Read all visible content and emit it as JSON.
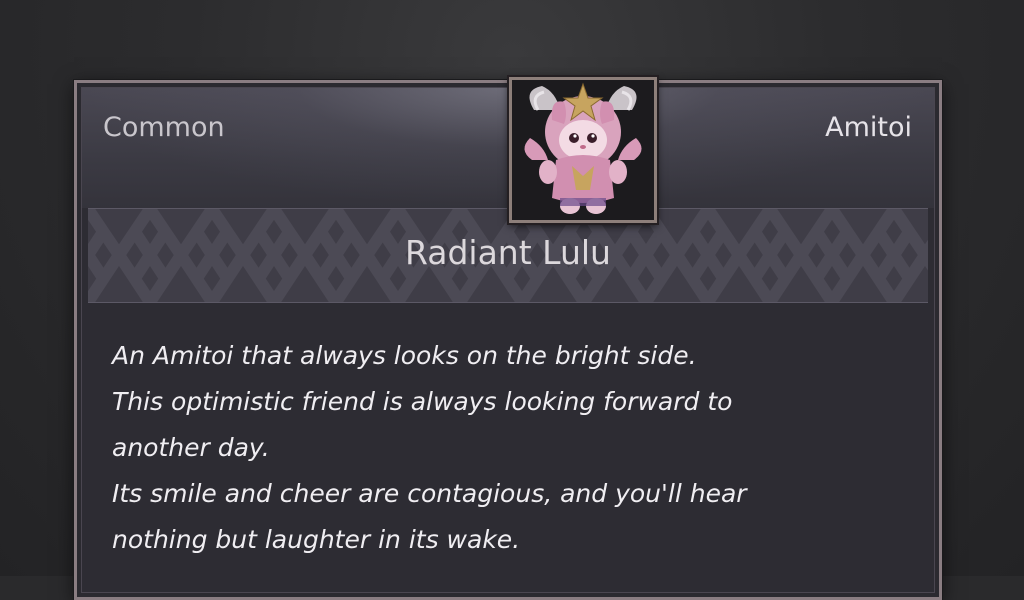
{
  "item": {
    "rarity": "Common",
    "category": "Amitoi",
    "name": "Radiant Lulu",
    "portrait_icon": "amitoi-portrait",
    "description_lines": [
      "An Amitoi that always looks on the bright side.",
      "This optimistic friend is always looking forward to",
      "another day.",
      "Its smile and cheer are contagious, and you'll hear",
      "nothing but laughter in its wake."
    ]
  },
  "colors": {
    "frame": "#8a7d82",
    "card_bg": "#2d2c33",
    "banner_bg": "#3f3d47",
    "text": "#f0eef2"
  }
}
